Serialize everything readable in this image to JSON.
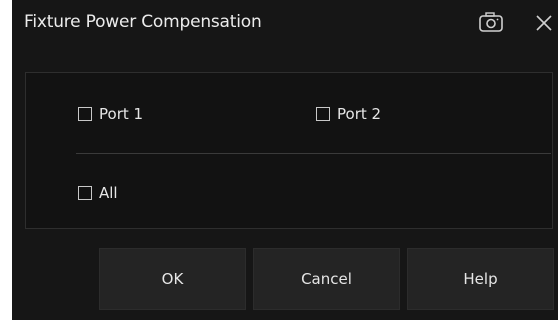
{
  "dialog": {
    "title": "Fixture Power Compensation"
  },
  "title_bar_icons": {
    "camera": "camera-icon",
    "close": "close-icon"
  },
  "ports": {
    "port1": {
      "label": "Port 1",
      "checked": false
    },
    "port2": {
      "label": "Port 2",
      "checked": false
    },
    "all": {
      "label": "All",
      "checked": false
    }
  },
  "buttons": {
    "ok": "OK",
    "cancel": "Cancel",
    "help": "Help"
  },
  "colors": {
    "background": "#161616",
    "button": "#242424",
    "text": "#e6e6e6"
  }
}
